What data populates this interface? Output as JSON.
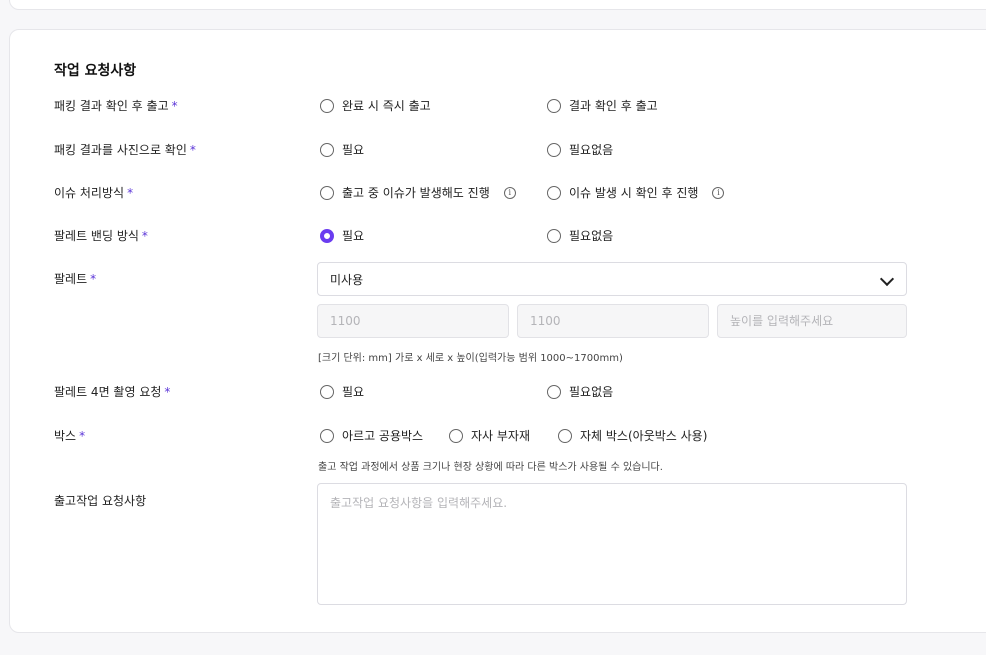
{
  "section": {
    "title": "작업 요청사항"
  },
  "rows": {
    "packing_release": {
      "label": "패킹 결과 확인 후 출고",
      "options": [
        "완료 시 즉시 출고",
        "결과 확인 후 출고"
      ]
    },
    "packing_photo": {
      "label": "패킹 결과를 사진으로 확인",
      "options": [
        "필요",
        "필요없음"
      ]
    },
    "issue_handling": {
      "label": "이슈 처리방식",
      "options": [
        "출고 중 이슈가 발생해도 진행",
        "이슈 발생 시 확인 후 진행"
      ]
    },
    "pallet_banding": {
      "label": "팔레트 밴딩 방식",
      "options": [
        "필요",
        "필요없음"
      ],
      "selected_index": 0
    },
    "pallet": {
      "label": "팔레트",
      "selected": "미사용",
      "width_placeholder": "1100",
      "depth_placeholder": "1100",
      "height_placeholder": "높이를 입력해주세요",
      "hint": "[크기 단위: mm] 가로 x 세로 x 높이(입력가능 범위 1000~1700mm)"
    },
    "pallet_photo": {
      "label": "팔레트 4면 촬영 요청",
      "options": [
        "필요",
        "필요없음"
      ]
    },
    "box": {
      "label": "박스",
      "options": [
        "아르고 공용박스",
        "자사 부자재",
        "자체 박스(아웃박스 사용)"
      ],
      "hint": "출고 작업 과정에서 상품 크기나 현장 상황에 따라 다른 박스가 사용될 수 있습니다."
    },
    "memo": {
      "label": "출고작업 요청사항",
      "placeholder": "출고작업 요청사항을 입력해주세요."
    }
  },
  "required_mark": "*",
  "info_icon_glyph": "i",
  "colors": {
    "accent": "#6a3cf0",
    "required": "#5b35d8"
  }
}
